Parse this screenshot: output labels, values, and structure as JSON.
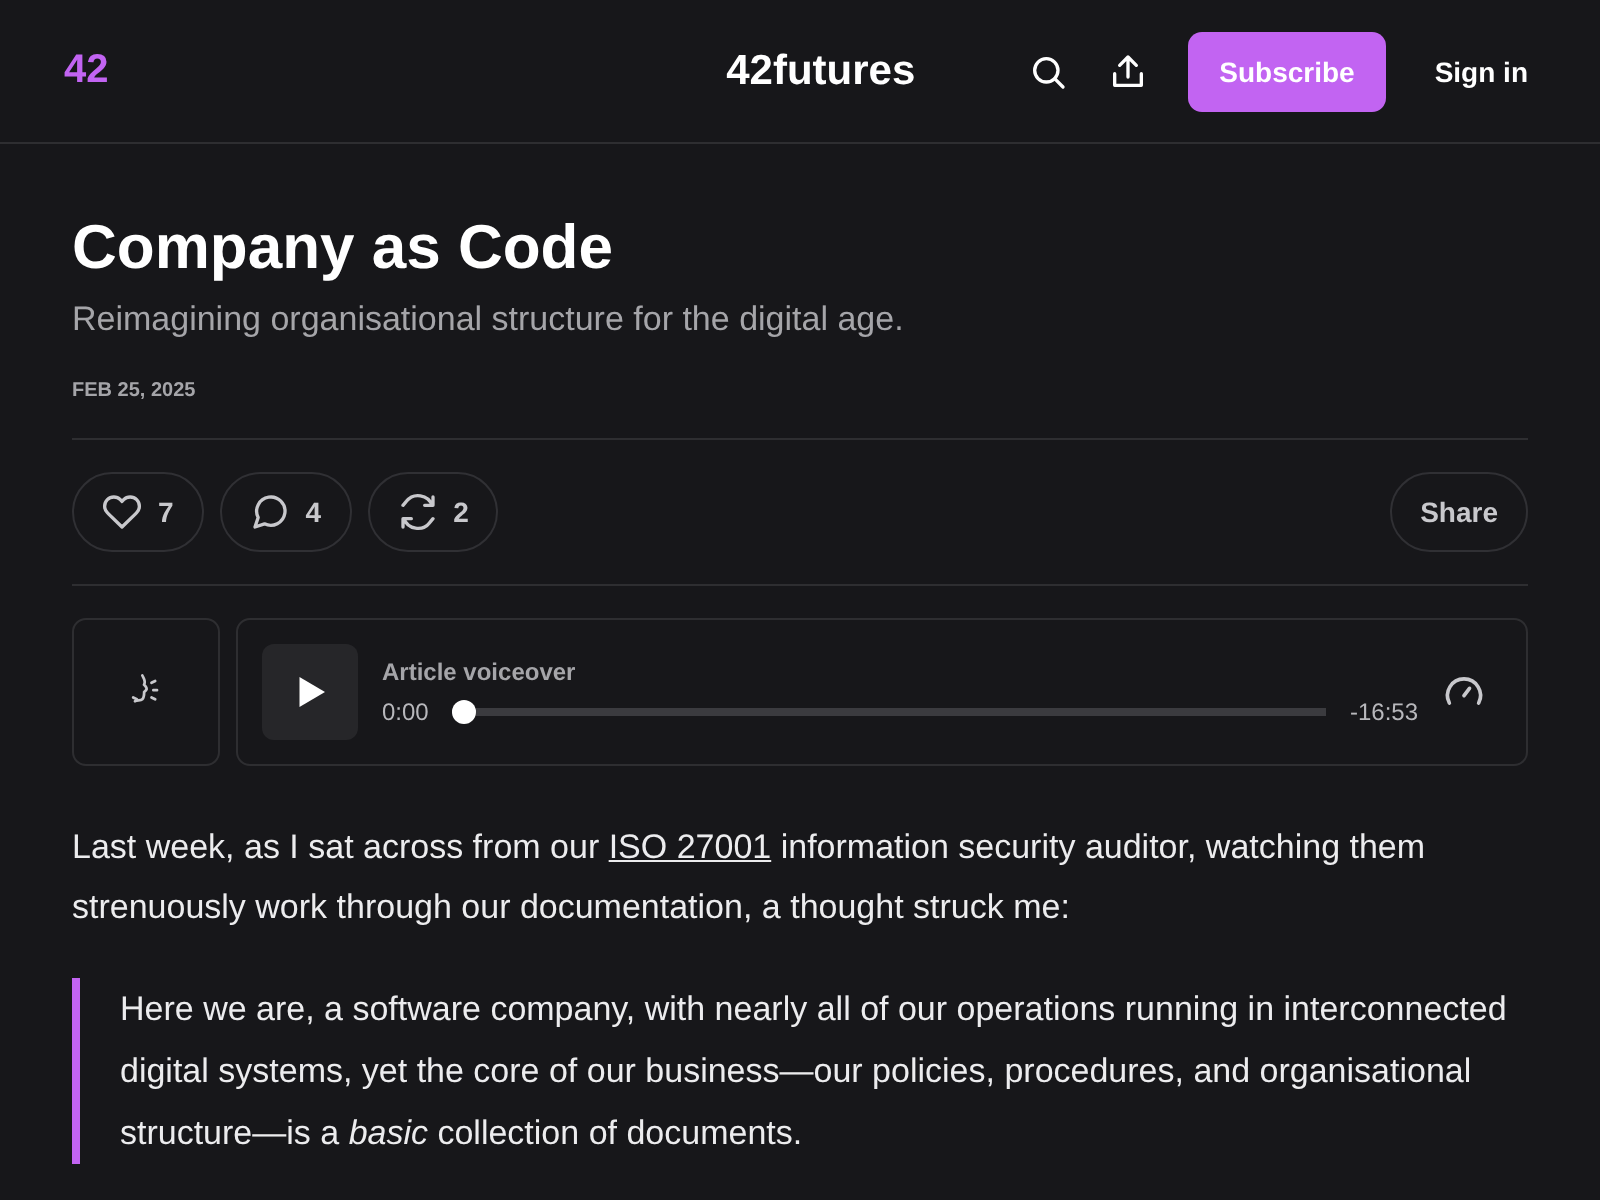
{
  "header": {
    "logo": "42",
    "site_name": "42futures",
    "subscribe_label": "Subscribe",
    "sign_in_label": "Sign in"
  },
  "article": {
    "title": "Company as Code",
    "subtitle": "Reimagining organisational structure for the digital age.",
    "date": "FEB 25, 2025"
  },
  "actions": [
    {
      "kind": "like",
      "count": "7"
    },
    {
      "kind": "comment",
      "count": "4"
    },
    {
      "kind": "restack",
      "count": "2"
    }
  ],
  "share_label": "Share",
  "player": {
    "title": "Article voiceover",
    "elapsed": "0:00",
    "remaining": "-16:53",
    "level": 0
  },
  "body": [
    {
      "kind": "paragraph",
      "text": "Last week, as I sat across from our ",
      "link": "ISO 27001",
      "rest": " information security auditor, watching them strenuously work through our documentation, a thought struck me:"
    },
    {
      "kind": "quote",
      "text": "Here we are, a software company, with nearly all of our operations running in interconnected digital systems, yet the core of our business—our policies, procedures, and organisational structure—is a *basic* collection of documents."
    }
  ]
}
